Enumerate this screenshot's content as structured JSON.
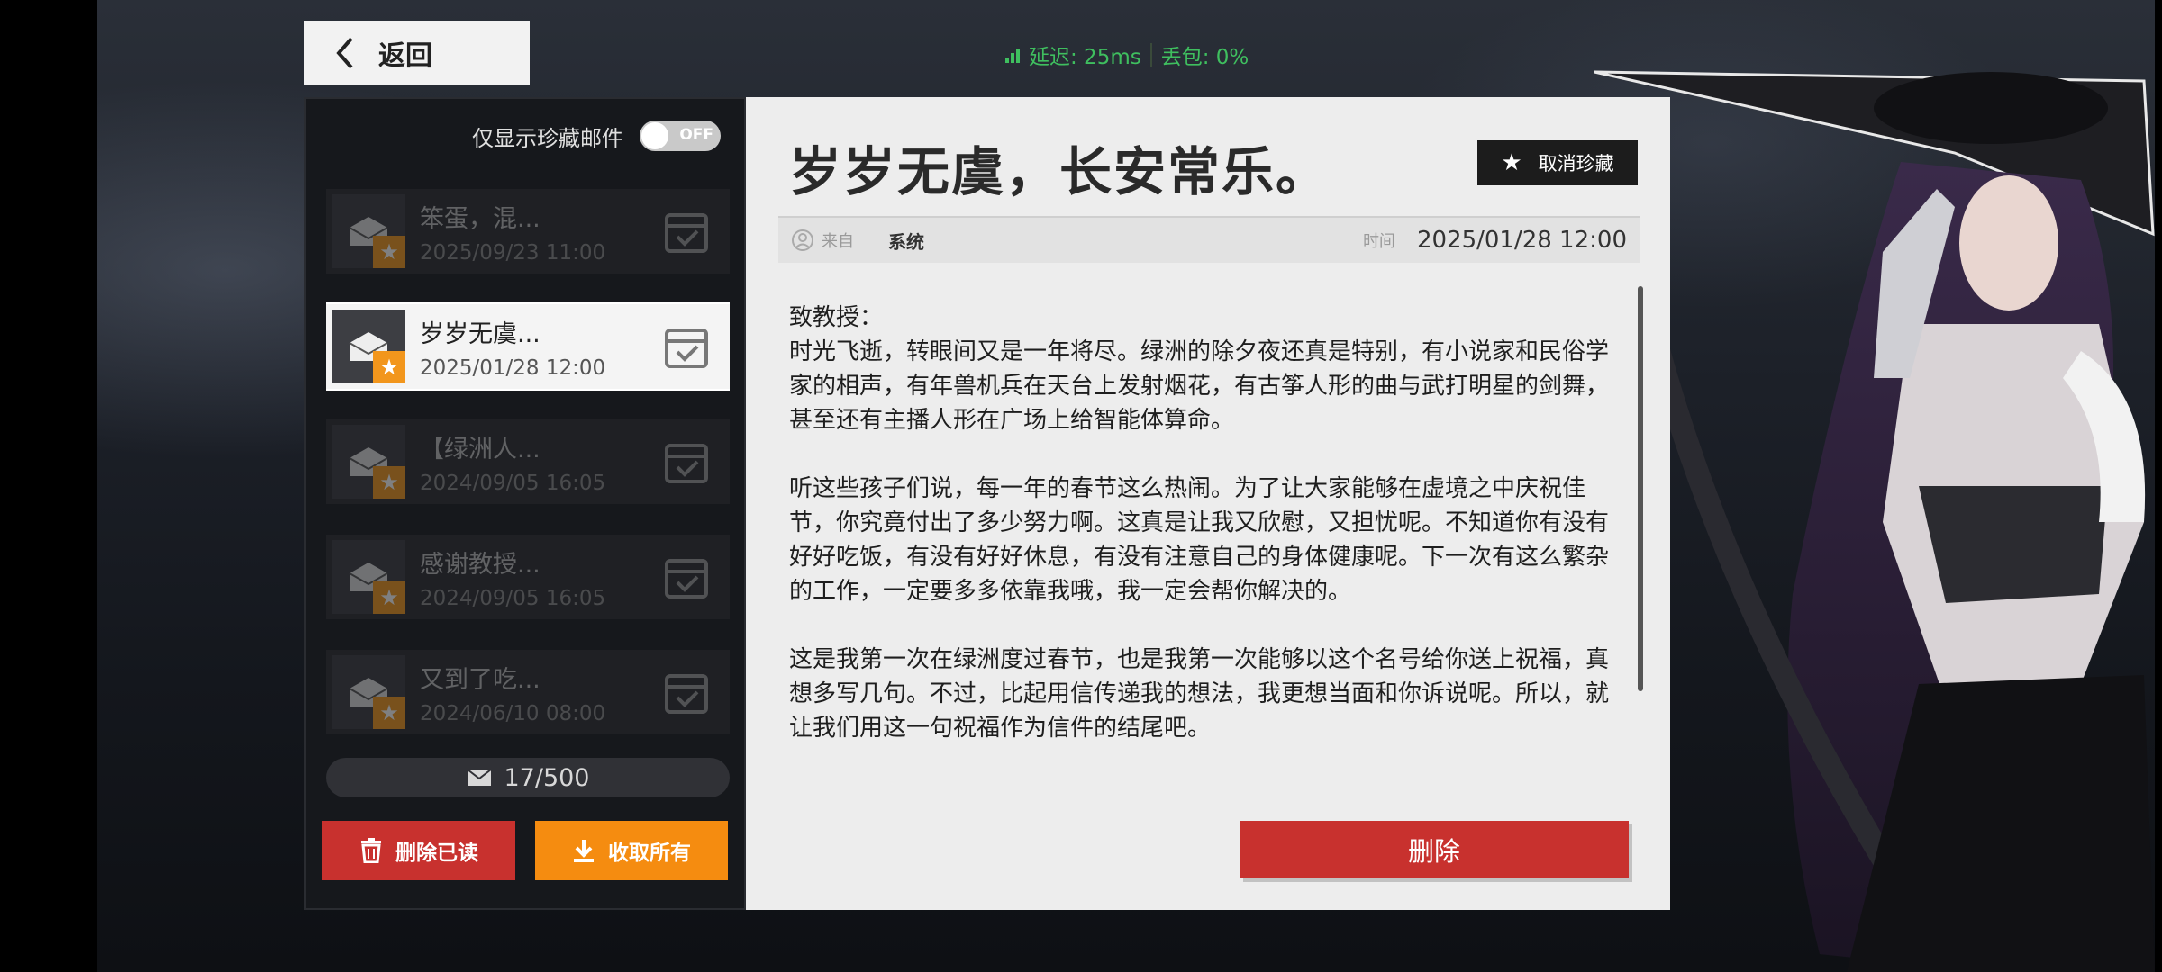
{
  "top_bar": {
    "back_label": "返回",
    "latency": "延迟: 25ms",
    "packet_loss": "丢包: 0%"
  },
  "mail_list": {
    "filter_label": "仅显示珍藏邮件",
    "filter_toggle_text": "OFF",
    "items": [
      {
        "title": "笨蛋，混...",
        "date": "2025/09/23 11:00"
      },
      {
        "title": "岁岁无虞...",
        "date": "2025/01/28 12:00"
      },
      {
        "title": "【绿洲人...",
        "date": "2024/09/05 16:05"
      },
      {
        "title": "感谢教授...",
        "date": "2024/09/05 16:05"
      },
      {
        "title": "又到了吃...",
        "date": "2024/06/10 08:00"
      }
    ],
    "count": "17/500",
    "delete_read_label": "删除已读",
    "collect_all_label": "收取所有"
  },
  "mail_detail": {
    "title": "岁岁无虞，长安常乐。",
    "unfavorite_label": "取消珍藏",
    "from_label": "来自",
    "sender": "系统",
    "time_label": "时间",
    "time": "2025/01/28 12:00",
    "salutation": "致教授：",
    "paragraphs": [
      "时光飞逝，转眼间又是一年将尽。绿洲的除夕夜还真是特别，有小说家和民俗学家的相声，有年兽机兵在天台上发射烟花，有古筝人形的曲与武打明星的剑舞，甚至还有主播人形在广场上给智能体算命。",
      "听这些孩子们说，每一年的春节这么热闹。为了让大家能够在虚境之中庆祝佳节，你究竟付出了多少努力啊。这真是让我又欣慰，又担忧呢。不知道你有没有好好吃饭，有没有好好休息，有没有注意自己的身体健康呢。下一次有这么繁杂的工作，一定要多多依靠我哦，我一定会帮你解决的。",
      "这是我第一次在绿洲度过春节，也是我第一次能够以这个名号给你送上祝福，真想多写几句。不过，比起用信传递我的想法，我更想当面和你诉说呢。所以，就让我们用这一句祝福作为信件的结尾吧。"
    ],
    "delete_label": "删除"
  },
  "colors": {
    "accent_red": "#c8312e",
    "accent_orange": "#f58c10",
    "star_orange": "#f2961c",
    "net_green": "#3fbf5f"
  }
}
